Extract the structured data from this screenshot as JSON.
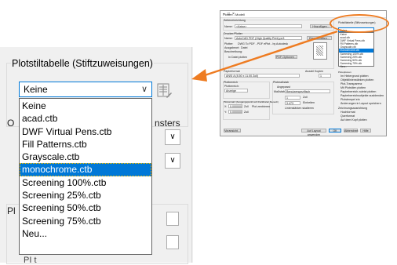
{
  "zoom": {
    "group_title": "Plotstiltabelle (Stiftzuweisungen)",
    "combo_value": "Keine",
    "options": [
      "Keine",
      "acad.ctb",
      "DWF Virtual Pens.ctb",
      "Fill Patterns.ctb",
      "Grayscale.ctb",
      "monochrome.ctb",
      "Screening 100%.ctb",
      "Screening 25%.ctb",
      "Screening 50%.ctb",
      "Screening 75%.ctb",
      "Neu..."
    ],
    "selected_index": 5,
    "partial_left_1": "O",
    "partial_right_1": "nsters",
    "partial_left_2": "Pl",
    "bottom_stub": "PI t"
  },
  "dialog": {
    "title": "Plotten - Modell",
    "page_setup_label": "Seiteneinrichtung",
    "name_label": "Name:",
    "name_value": "<Keine>",
    "add_button": "Hinzufügen...",
    "printer_section": "Drucker/Plotter",
    "printer_name_label": "Name:",
    "printer_name_value": "AutoCAD PDF (High Quality Print).pc3",
    "properties_button": "Eigenschaften...",
    "plotter_label": "Plotter:",
    "plotter_value": "DWG To PDF - PDF ePlot - by Autodesk",
    "location_label": "Ausgabeort:",
    "location_value": "Datei",
    "description_label": "Beschreibung:",
    "plot_to_file": "In Datei plotten",
    "pdf_options": "PDF-Optionen...",
    "paper_size_label": "Papierformat",
    "paper_size_value": "ANSI A (8.50 x 11.00 Zoll)",
    "copies_label": "Anzahl Kopien",
    "copies_value": "1",
    "plot_area_label": "Plotbereich",
    "plot_what_label": "Plotbereich:",
    "plot_what_value": "Anzeige",
    "plot_offset_label": "Plotversatz (Ausgangspunkt auf druckbaren Bereich)",
    "x_label": "X:",
    "x_value": "0.000000",
    "x_unit": "Zoll",
    "center_plot": "Plot zentrieren",
    "y_label": "Y:",
    "y_value": "0.000000",
    "y_unit": "Zoll",
    "scale_label": "Plotmaßstab",
    "fit_paper": "Angepasst",
    "scale_field_label": "Maßstab:",
    "scale_value": "Benutzerspezifisch",
    "scale_num": "1",
    "scale_unit": "Zoll",
    "scale_den": "3.473",
    "scale_den_unit": "Einheiten",
    "lineweights": "Linienstärken skalieren",
    "style_table_label": "Plotstiltabelle (Stiftzuweisungen)",
    "style_table_value": "Keine",
    "list": [
      "Keine",
      "acad.ctb",
      "DWF Virtual Pens.ctb",
      "Fill Patterns.ctb",
      "Grayscale.ctb",
      "monochrome.ctb",
      "Screening 100%.ctb",
      "Screening 25%.ctb",
      "Screening 50%.ctb",
      "Screening 75%.ctb",
      "Neu..."
    ],
    "shaded_label": "Optionen für schattierte Ansichtsfenster",
    "plot_options_label": "Plotoptionen",
    "opt_background": "Im Hintergrund plotten",
    "opt_lineweights": "Objektlinienstärken plotten",
    "opt_transparency": "Plot-Transparenz",
    "opt_styles": "Mit Plotstilen plotten",
    "opt_paperspace_last": "Papierbereich zuletzt plotten",
    "opt_hide": "Papierbereichsobjekte ausblenden",
    "opt_stamp": "Plotstempel ein",
    "opt_save": "Änderungen in Layout speichern",
    "orientation_label": "Zeichnungsausrichtung",
    "portrait": "Hochformat",
    "landscape": "Querformat",
    "upside_down": "Auf dem Kopf plotten",
    "preview_button": "Voransicht...",
    "apply_button": "Auf Layout anwenden",
    "ok_button": "OK",
    "cancel_button": "Abbrechen",
    "help_button": "Hilfe",
    "mm_label": "Zoll"
  },
  "colors": {
    "accent": "#0078d7",
    "callout": "#ee7c22"
  }
}
